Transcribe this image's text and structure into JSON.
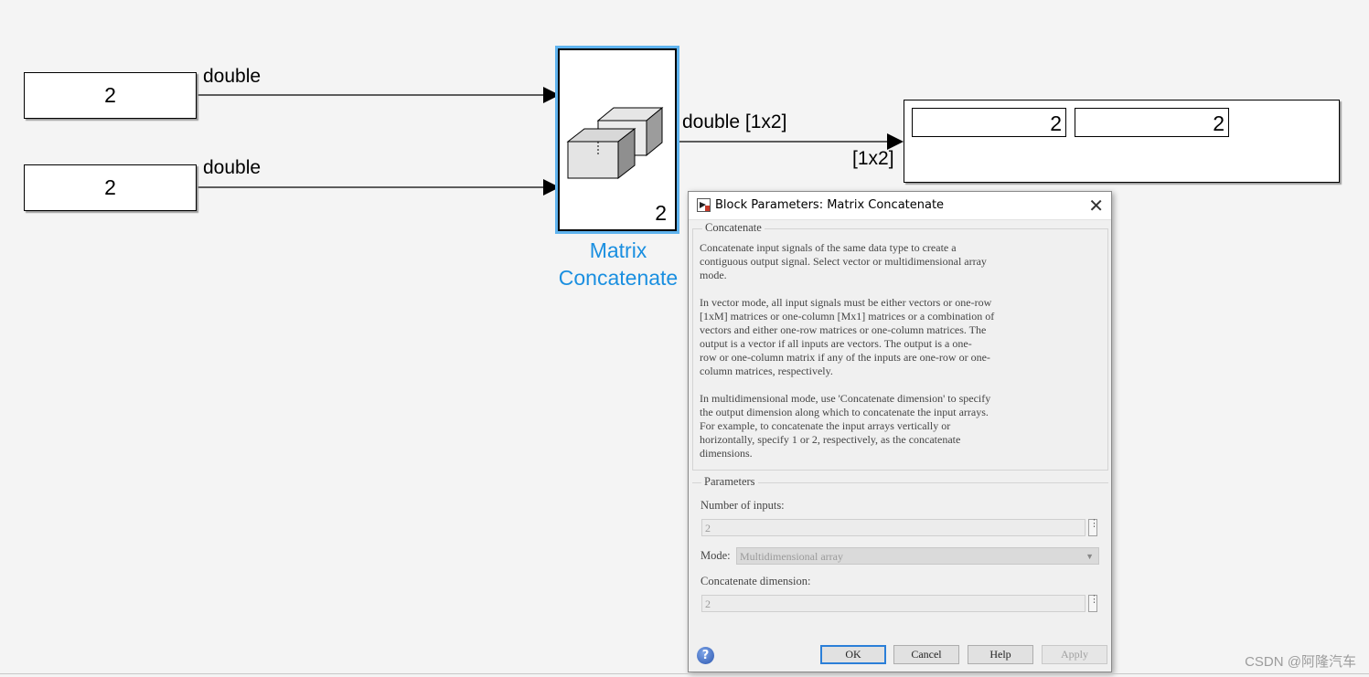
{
  "model": {
    "const1": {
      "value": "2",
      "signal_type": "double"
    },
    "const2": {
      "value": "2",
      "signal_type": "double"
    },
    "concat_block": {
      "inputs_shown": "2",
      "name_line1": "Matrix",
      "name_line2": "Concatenate"
    },
    "output_signal": {
      "label": "double [1x2]",
      "port_dim": "[1x2]"
    },
    "display": {
      "values": [
        "2",
        "2"
      ]
    }
  },
  "dialog": {
    "title": "Block Parameters: Matrix Concatenate",
    "close_label": "✕",
    "description_group": "Concatenate",
    "description_paragraphs": [
      "Concatenate input signals of the same data type to create a\ncontiguous output signal. Select vector or multidimensional array\nmode.",
      "In vector mode, all input signals must be either vectors or one-row\n[1xM] matrices or one-column [Mx1] matrices or a combination of\nvectors and either one-row matrices or one-column matrices. The\noutput is a vector if all inputs are vectors. The output is a one-\nrow or one-column matrix if any of the inputs are one-row or one-\ncolumn matrices, respectively.",
      "In multidimensional mode, use 'Concatenate dimension' to specify\nthe output dimension along which to concatenate the input arrays.\nFor example, to concatenate the input arrays vertically or\nhorizontally, specify 1 or 2, respectively, as the concatenate\ndimensions."
    ],
    "parameters_group": "Parameters",
    "num_inputs_label": "Number of inputs:",
    "num_inputs_value": "2",
    "mode_label": "Mode:",
    "mode_value": "Multidimensional array",
    "dim_label": "Concatenate dimension:",
    "dim_value": "2",
    "buttons": {
      "ok": "OK",
      "cancel": "Cancel",
      "help": "Help",
      "apply": "Apply"
    },
    "help_icon": "?",
    "dots_icon": "⋮"
  },
  "watermark": "CSDN @阿隆汽车"
}
